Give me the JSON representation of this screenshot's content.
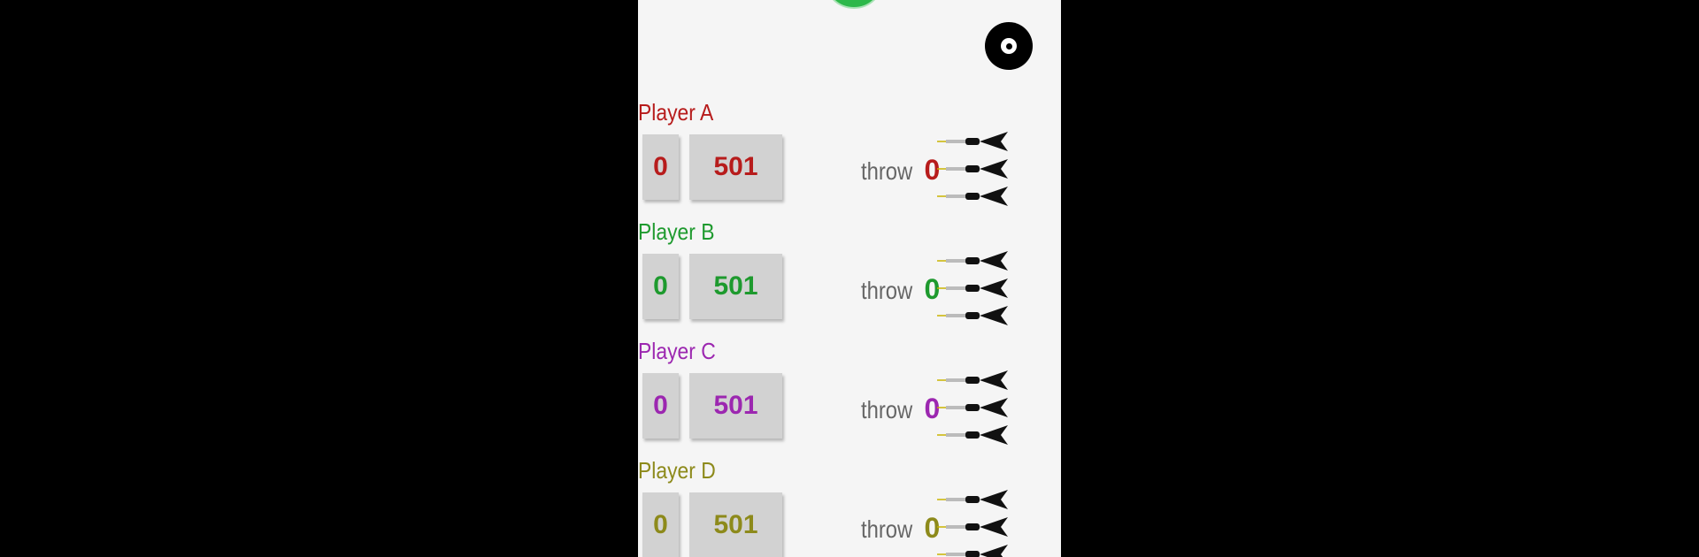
{
  "screen": {
    "board_icon": "dartboard-icon",
    "dart_icon": "dart-icon",
    "top_button_color": "#2db84a"
  },
  "players": [
    {
      "name": "Player A",
      "legs": "0",
      "score": "501",
      "throw_label": "throw",
      "throw_count": "0",
      "color": "#b71c1c"
    },
    {
      "name": "Player B",
      "legs": "0",
      "score": "501",
      "throw_label": "throw",
      "throw_count": "0",
      "color": "#1e9a2e"
    },
    {
      "name": "Player C",
      "legs": "0",
      "score": "501",
      "throw_label": "throw",
      "throw_count": "0",
      "color": "#9c27b0"
    },
    {
      "name": "Player D",
      "legs": "0",
      "score": "501",
      "throw_label": "throw",
      "throw_count": "0",
      "color": "#8d8a1b"
    }
  ]
}
